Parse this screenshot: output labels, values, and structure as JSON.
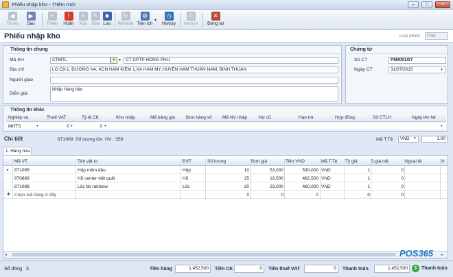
{
  "window": {
    "title": "Phiếu nhập kho - Thêm mới",
    "minimize": "–",
    "maximize": "□",
    "close": "×"
  },
  "toolbar": {
    "items": [
      {
        "label": "Trước",
        "icon": "◀",
        "color": "#6b88b2",
        "enabled": false
      },
      {
        "label": "Sau",
        "icon": "▶",
        "color": "#6b88b2",
        "enabled": true
      },
      {
        "label": "Thêm",
        "icon": "+",
        "color": "#3a9a3a",
        "enabled": false
      },
      {
        "label": "Hoãn",
        "icon": "!",
        "color": "#d23b2b",
        "enabled": true
      },
      {
        "label": "Xóa",
        "icon": "×",
        "color": "#d23b2b",
        "enabled": false
      },
      {
        "label": "Sửa",
        "icon": "✎",
        "color": "#5f7fa8",
        "enabled": false
      },
      {
        "label": "Lưu",
        "icon": "■",
        "color": "#3b63a8",
        "enabled": true
      },
      {
        "label": "Refresh",
        "icon": "↻",
        "color": "#5f7fa8",
        "enabled": false
      },
      {
        "label": "Tiện ích",
        "icon": "⚙",
        "color": "#4f79b0",
        "enabled": true
      },
      {
        "label": "History",
        "icon": "◷",
        "color": "#2f6db5",
        "enabled": true
      },
      {
        "label": "Xem in",
        "icon": "⎙",
        "color": "#5f7fa8",
        "enabled": false
      },
      {
        "label": "Đóng lại",
        "icon": "✕",
        "color": "#b34a3a",
        "enabled": true
      }
    ]
  },
  "header": {
    "title": "Phiếu nhập kho",
    "doc_type_label": "Loại phiếu",
    "doc_type_value": "PNK"
  },
  "general": {
    "title": "Thông tin chung",
    "customer_label": "Mã KH",
    "customer_code": "CTMTL",
    "customer_name": "CT CPTP HỒNG PHÚ",
    "address_label": "Địa chỉ",
    "address": "LÔ C9-1, ĐƯỜNG N4, KCN HÀM KIỆM 1,XÃ HÀM MỸ,HUYỆN HÀM THUẬN NAM, BÌNH THUẬN",
    "deliverer_label": "Người giao",
    "deliverer": "",
    "desc_label": "Diễn giải",
    "desc": "Nhập hàng bán"
  },
  "voucher": {
    "title": "Chứng từ",
    "no_label": "Số CT",
    "no": "PN0001/07",
    "date_label": "Ngày CT",
    "date": "31/07/2015"
  },
  "other": {
    "title": "Thông tin khác",
    "headers": [
      "Nghiệp vụ",
      "Thuế VAT",
      "Tỷ lệ CK",
      "Kho nhập",
      "Mã bảng giá",
      "Đơn hàng số",
      "Mã NV nhập",
      "Nợ cũ",
      "Hạn trả",
      "Hợp đồng",
      "Số CTLH",
      "Ngày lên hệ"
    ],
    "values": [
      "MHTS",
      "0",
      "0",
      "",
      "",
      "",
      "",
      "",
      "",
      "",
      "",
      ""
    ]
  },
  "detail": {
    "title": "Chi tiết",
    "product_code": "871089",
    "stock_label": "Số lượng tồn",
    "stock_info": "HV : 356",
    "currency_label": "Mã T.Tệ",
    "currency": "VND",
    "rate": "1.00",
    "tab": "1. Hàng hóa",
    "columns": [
      "Mã VT",
      "Tên vật tư",
      "ĐVT",
      "Số lượng",
      "Đơn giá",
      "Tiền VND",
      "Mã T.Tệ",
      "Tỷ giá",
      "Đ.giá ntệ",
      "Ngoại tệ",
      "N"
    ],
    "rows": [
      {
        "code": "871095",
        "name": "Hộp mềm dầu",
        "unit": "Hộp",
        "qty": "10",
        "price": "53,000",
        "amount": "530,000",
        "cur": "VND",
        "rate": "1",
        "fprice": "0",
        "famount": ""
      },
      {
        "code": "870889",
        "name": "Hũ center việt quất",
        "unit": "Hũ",
        "qty": "25",
        "price": "18,500",
        "amount": "462,500",
        "cur": "VND",
        "rate": "1",
        "fprice": "0",
        "famount": ""
      },
      {
        "code": "871089",
        "name": "Lốc bb rainbow",
        "unit": "Lốc",
        "qty": "20",
        "price": "23,000",
        "amount": "460,000",
        "cur": "VND",
        "rate": "1",
        "fprice": "0",
        "famount": ""
      }
    ],
    "new_row": {
      "placeholder": "Chọn mã hàng ở đây",
      "qty": "0",
      "price": "0",
      "amount": "0",
      "rate": "0",
      "fprice": "0"
    }
  },
  "footer": {
    "rows_label": "Số dòng",
    "rows_count": "3",
    "goods_label": "Tiền hàng",
    "goods": "1,452,500",
    "ck_label": "Tiền CK",
    "ck": "0",
    "vat_label": "Tiền thuế VAT",
    "vat": "0",
    "pay_label": "Thanh toán",
    "pay": "1,452,500",
    "pay_button": "Thanh toán"
  },
  "brand": {
    "name": "POS365",
    "color": "#1f74c8"
  }
}
